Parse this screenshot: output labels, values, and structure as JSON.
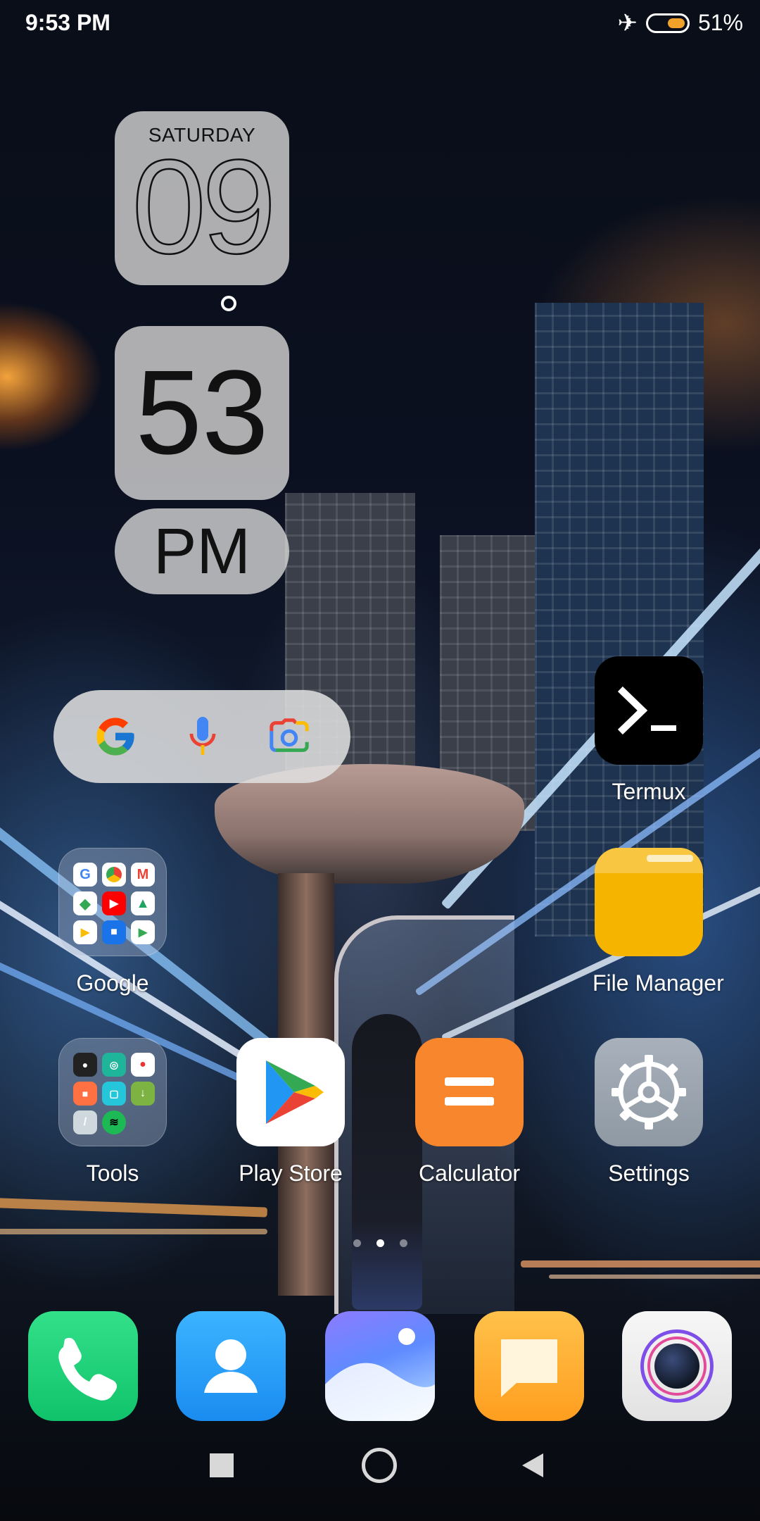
{
  "status_bar": {
    "time": "9:53 PM",
    "icons": [
      "airplane-mode-icon",
      "battery-icon"
    ],
    "battery_percent": "51%",
    "battery_level": 0.51
  },
  "clock_widget": {
    "weekday": "SATURDAY",
    "date": "09",
    "minute": "53",
    "ampm": "PM"
  },
  "search_widget": {
    "icons": [
      "google-g-icon",
      "microphone-icon",
      "lens-camera-icon"
    ]
  },
  "apps": {
    "termux": {
      "label": "Termux",
      "icon": "terminal-icon"
    },
    "file_manager": {
      "label": "File Manager",
      "icon": "folder-icon"
    },
    "google_folder": {
      "label": "Google",
      "icon": "folder-icon"
    },
    "tools_folder": {
      "label": "Tools",
      "icon": "folder-icon"
    },
    "play_store": {
      "label": "Play Store",
      "icon": "play-store-icon"
    },
    "calculator": {
      "label": "Calculator",
      "icon": "calculator-icon"
    },
    "settings": {
      "label": "Settings",
      "icon": "gear-icon"
    }
  },
  "page_indicator": {
    "pages": 3,
    "current": 1
  },
  "dock": [
    "phone-icon",
    "contacts-icon",
    "gallery-icon",
    "messages-icon",
    "camera-icon"
  ],
  "nav_bar": [
    "recents-button",
    "home-button",
    "back-button"
  ],
  "colors": {
    "termux_bg": "#000000",
    "file_manager_bg": "#f4b400",
    "calculator_bg": "#f7862c",
    "settings_bg": "#9aa3ad",
    "battery_fill": "#f0a12a"
  }
}
